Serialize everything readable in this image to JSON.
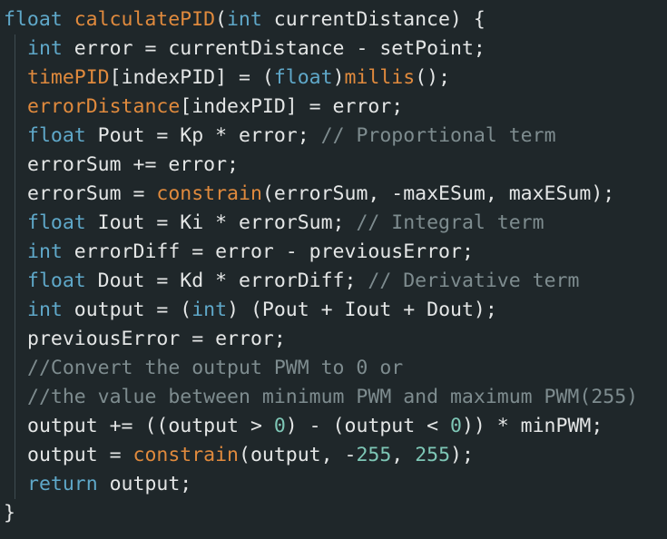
{
  "editor": {
    "language": "C++",
    "colors": {
      "background": "#1f272a",
      "keyword": "#5fa8c9",
      "function": "#e08a3d",
      "number": "#7ec7b6",
      "comment": "#7e8c8f",
      "text": "#e4e6e6"
    },
    "lines": [
      {
        "indent": 0,
        "tokens": [
          {
            "t": "kw",
            "v": "float"
          },
          {
            "t": "pl",
            "v": " "
          },
          {
            "t": "fn",
            "v": "calculatePID"
          },
          {
            "t": "pl",
            "v": "("
          },
          {
            "t": "kw",
            "v": "int"
          },
          {
            "t": "pl",
            "v": " currentDistance) {"
          }
        ]
      },
      {
        "indent": 1,
        "tokens": [
          {
            "t": "kw",
            "v": "int"
          },
          {
            "t": "pl",
            "v": " error = currentDistance - setPoint;"
          }
        ]
      },
      {
        "indent": 1,
        "tokens": [
          {
            "t": "fn",
            "v": "timePID"
          },
          {
            "t": "pl",
            "v": "[indexPID] = ("
          },
          {
            "t": "kw",
            "v": "float"
          },
          {
            "t": "pl",
            "v": ")"
          },
          {
            "t": "fn",
            "v": "millis"
          },
          {
            "t": "pl",
            "v": "();"
          }
        ]
      },
      {
        "indent": 1,
        "tokens": [
          {
            "t": "fn",
            "v": "errorDistance"
          },
          {
            "t": "pl",
            "v": "[indexPID] = error;"
          }
        ]
      },
      {
        "indent": 1,
        "tokens": [
          {
            "t": "kw",
            "v": "float"
          },
          {
            "t": "pl",
            "v": " Pout = Kp * error; "
          },
          {
            "t": "cm",
            "v": "// Proportional term"
          }
        ]
      },
      {
        "indent": 1,
        "tokens": [
          {
            "t": "pl",
            "v": "errorSum += error;"
          }
        ]
      },
      {
        "indent": 1,
        "tokens": [
          {
            "t": "pl",
            "v": "errorSum = "
          },
          {
            "t": "fn",
            "v": "constrain"
          },
          {
            "t": "pl",
            "v": "(errorSum, -maxESum, maxESum);"
          }
        ]
      },
      {
        "indent": 1,
        "tokens": [
          {
            "t": "kw",
            "v": "float"
          },
          {
            "t": "pl",
            "v": " Iout = Ki * errorSum; "
          },
          {
            "t": "cm",
            "v": "// Integral term"
          }
        ]
      },
      {
        "indent": 1,
        "tokens": [
          {
            "t": "kw",
            "v": "int"
          },
          {
            "t": "pl",
            "v": " errorDiff = error - previousError;"
          }
        ]
      },
      {
        "indent": 1,
        "tokens": [
          {
            "t": "kw",
            "v": "float"
          },
          {
            "t": "pl",
            "v": " Dout = Kd * errorDiff; "
          },
          {
            "t": "cm",
            "v": "// Derivative term"
          }
        ]
      },
      {
        "indent": 1,
        "tokens": [
          {
            "t": "kw",
            "v": "int"
          },
          {
            "t": "pl",
            "v": " output = ("
          },
          {
            "t": "kw",
            "v": "int"
          },
          {
            "t": "pl",
            "v": ") (Pout + Iout + Dout);"
          }
        ]
      },
      {
        "indent": 1,
        "tokens": [
          {
            "t": "pl",
            "v": "previousError = error;"
          }
        ]
      },
      {
        "indent": 1,
        "tokens": [
          {
            "t": "cm",
            "v": "//Convert the output PWM to 0 or"
          }
        ]
      },
      {
        "indent": 1,
        "tokens": [
          {
            "t": "cm",
            "v": "//the value between minimum PWM and maximum PWM(255)"
          }
        ]
      },
      {
        "indent": 1,
        "tokens": [
          {
            "t": "pl",
            "v": "output += ((output > "
          },
          {
            "t": "num",
            "v": "0"
          },
          {
            "t": "pl",
            "v": ") - (output < "
          },
          {
            "t": "num",
            "v": "0"
          },
          {
            "t": "pl",
            "v": ")) * minPWM;"
          }
        ]
      },
      {
        "indent": 1,
        "tokens": [
          {
            "t": "pl",
            "v": "output = "
          },
          {
            "t": "fn",
            "v": "constrain"
          },
          {
            "t": "pl",
            "v": "(output, -"
          },
          {
            "t": "num",
            "v": "255"
          },
          {
            "t": "pl",
            "v": ", "
          },
          {
            "t": "num",
            "v": "255"
          },
          {
            "t": "pl",
            "v": ");"
          }
        ]
      },
      {
        "indent": 1,
        "tokens": [
          {
            "t": "kw",
            "v": "return"
          },
          {
            "t": "pl",
            "v": " output;"
          }
        ]
      },
      {
        "indent": 0,
        "tokens": [
          {
            "t": "pl",
            "v": "}"
          }
        ]
      }
    ]
  }
}
